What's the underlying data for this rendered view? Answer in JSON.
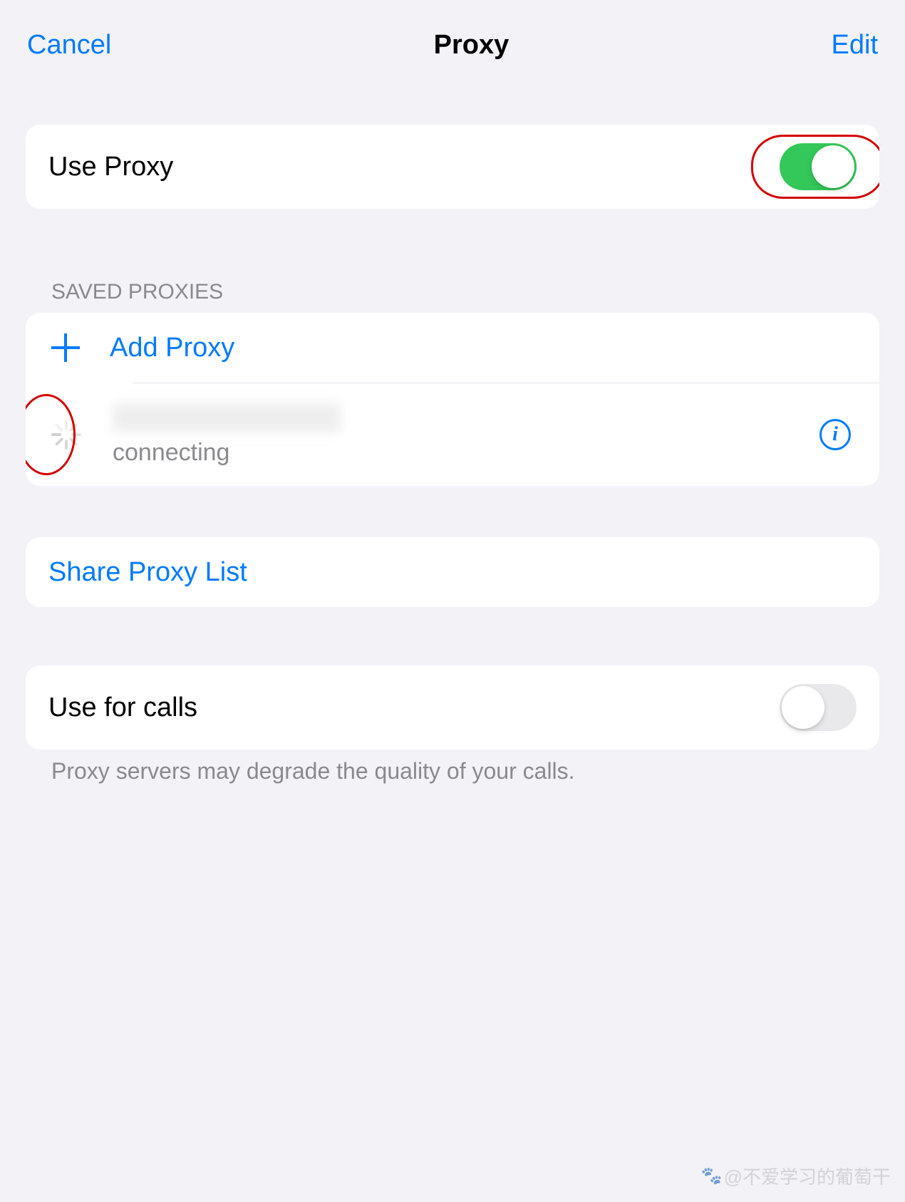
{
  "header": {
    "cancel": "Cancel",
    "title": "Proxy",
    "edit": "Edit"
  },
  "useProxy": {
    "label": "Use Proxy",
    "enabled": true
  },
  "savedProxies": {
    "header": "SAVED PROXIES",
    "addProxy": "Add Proxy",
    "items": [
      {
        "status": "connecting"
      }
    ]
  },
  "shareProxyList": {
    "label": "Share Proxy List"
  },
  "useForCalls": {
    "label": "Use for calls",
    "enabled": false,
    "footer": "Proxy servers may degrade the quality of your calls."
  },
  "watermark": "@不爱学习的葡萄干"
}
